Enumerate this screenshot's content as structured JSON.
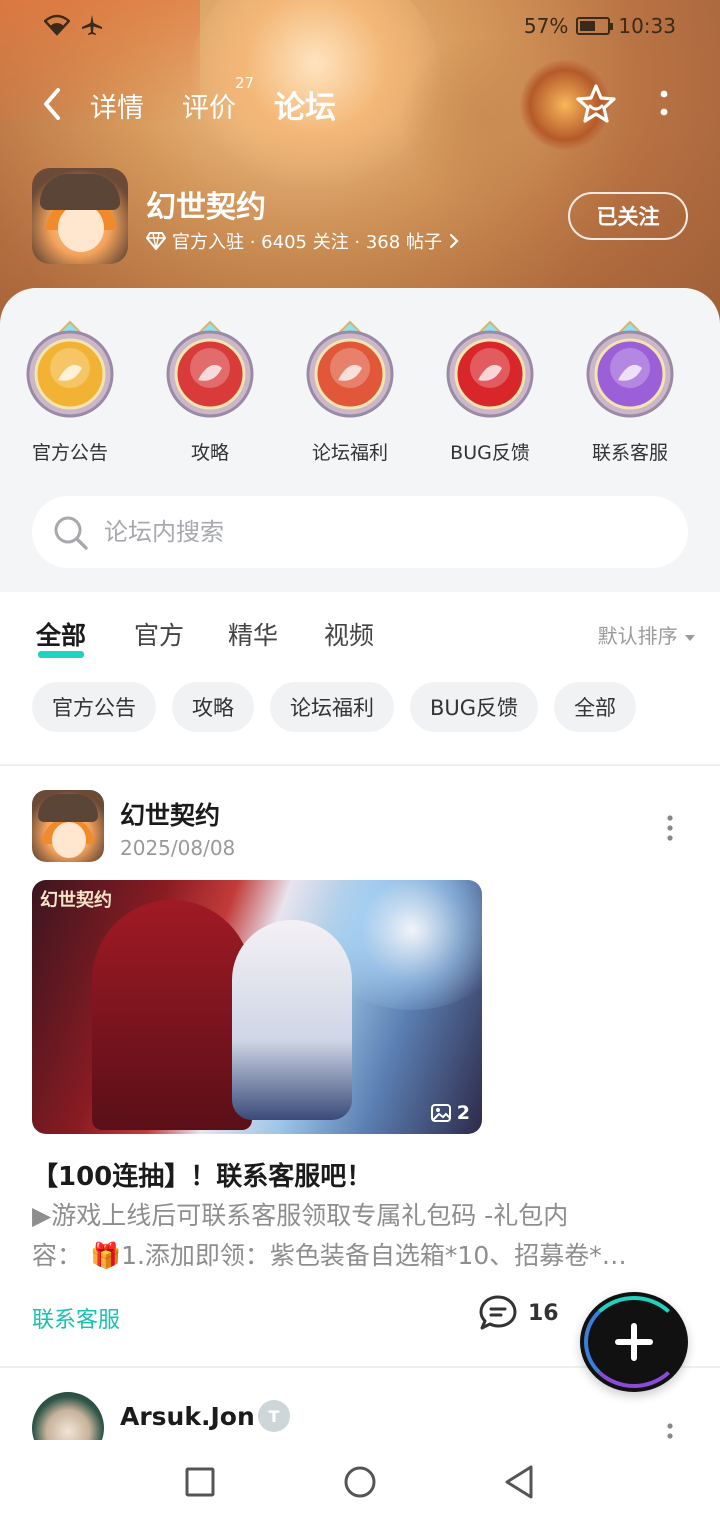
{
  "status": {
    "battery": "57%",
    "time": "10:33",
    "battery_level": 0.57
  },
  "nav": {
    "tabs": [
      "详情",
      "评价",
      "论坛"
    ],
    "review_count": "27",
    "active_tab": "论坛"
  },
  "game": {
    "name": "幻世契约",
    "meta": "官方入驻 · 6405 关注 · 368 帖子",
    "follow_label": "已关注"
  },
  "categories": [
    {
      "label": "官方公告",
      "color": "#f2b233"
    },
    {
      "label": "攻略",
      "color": "#d93a3a"
    },
    {
      "label": "论坛福利",
      "color": "#e0573a"
    },
    {
      "label": "BUG反馈",
      "color": "#d8262a"
    },
    {
      "label": "联系客服",
      "color": "#9b5fd8"
    }
  ],
  "search": {
    "placeholder": "论坛内搜索"
  },
  "filter_tabs": [
    "全部",
    "官方",
    "精华",
    "视频"
  ],
  "sort_label": "默认排序",
  "chips": [
    "官方公告",
    "攻略",
    "论坛福利",
    "BUG反馈",
    "全部"
  ],
  "post": {
    "author": "幻世契约",
    "date": "2025/08/08",
    "image_logo": "幻世契约",
    "image_count": "2",
    "title": "【100连抽】！联系客服吧！",
    "body_line1": "▶游戏上线后可联系客服领取专属礼包码 -礼包内",
    "body_line2": "容： 🎁1.添加即领：紫色装备自选箱*10、招募卷*…",
    "tag": "联系客服",
    "comments": "16"
  },
  "post2": {
    "author": "Arsuk.Jon",
    "level_badge": "T"
  },
  "colors": {
    "accent": "#20d2c0",
    "link": "#19c2b0"
  }
}
